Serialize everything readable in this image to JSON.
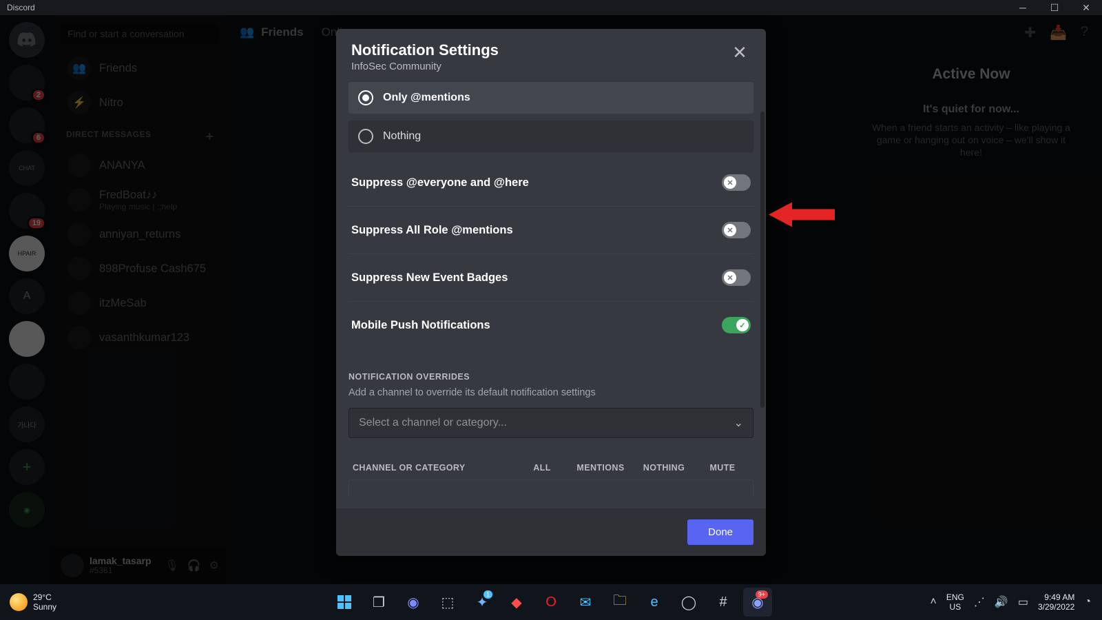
{
  "app_name": "Discord",
  "header": {
    "friends_label": "Friends",
    "online_label": "Online"
  },
  "search_placeholder": "Find or start a conversation",
  "nav": {
    "friends": "Friends",
    "nitro": "Nitro"
  },
  "dm_header": "DIRECT MESSAGES",
  "dms": [
    {
      "name": "ANANYA",
      "sub": ""
    },
    {
      "name": "FredBoat♪♪",
      "sub": "Playing music | ;;help"
    },
    {
      "name": "anniyan_returns",
      "sub": ""
    },
    {
      "name": "898Profuse Cash675",
      "sub": ""
    },
    {
      "name": "itzMeSab",
      "sub": ""
    },
    {
      "name": "vasanthkumar123",
      "sub": ""
    }
  ],
  "user": {
    "name": "lamak_tasarp",
    "tag": "#5361"
  },
  "server_badges": {
    "s1": "2",
    "s2": "6",
    "s3": "19"
  },
  "active_now": {
    "title": "Active Now",
    "quiet": "It's quiet for now...",
    "sub": "When a friend starts an activity – like playing a game or hanging out on voice – we'll show it here!"
  },
  "modal": {
    "title": "Notification Settings",
    "subtitle": "InfoSec Community",
    "radios": {
      "mentions": "Only @mentions",
      "nothing": "Nothing"
    },
    "toggles": {
      "suppress_everyone": "Suppress @everyone and @here",
      "suppress_roles": "Suppress All Role @mentions",
      "suppress_events": "Suppress New Event Badges",
      "mobile_push": "Mobile Push Notifications"
    },
    "toggle_states": {
      "suppress_everyone": false,
      "suppress_roles": false,
      "suppress_events": false,
      "mobile_push": true
    },
    "overrides_header": "NOTIFICATION OVERRIDES",
    "overrides_sub": "Add a channel to override its default notification settings",
    "override_select_placeholder": "Select a channel or category...",
    "table_headers": {
      "channel": "CHANNEL OR CATEGORY",
      "all": "ALL",
      "mentions": "MENTIONS",
      "nothing": "NOTHING",
      "mute": "MUTE"
    },
    "done": "Done"
  },
  "taskbar": {
    "temp": "29°C",
    "cond": "Sunny",
    "lang1": "ENG",
    "lang2": "US",
    "time": "9:49 AM",
    "date": "3/29/2022"
  },
  "colors": {
    "accent": "#5865f2",
    "toggle_on": "#3ba55d",
    "danger": "#ed4245",
    "arrow": "#e52424"
  }
}
